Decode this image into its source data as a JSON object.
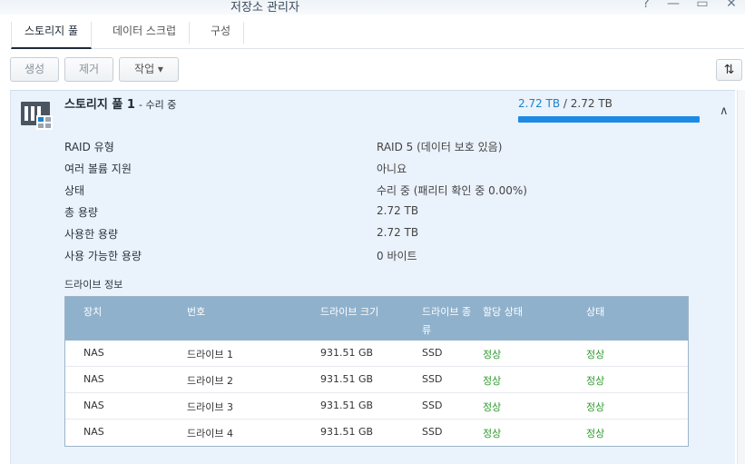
{
  "window": {
    "title": "저장소 관리자",
    "help": "?",
    "minimize": "—",
    "maximize": "▭",
    "close": "✕"
  },
  "tabs": [
    {
      "label": "스토리지 풀",
      "active": true
    },
    {
      "label": "데이터 스크럽",
      "active": false
    },
    {
      "label": "구성",
      "active": false
    }
  ],
  "toolbar": {
    "create": "생성",
    "remove": "제거",
    "action": "작업 ▾",
    "sort_icon": "⇅"
  },
  "pool": {
    "name": "스토리지 풀 1",
    "status": "- 수리 중",
    "used": "2.72 TB",
    "separator": " / ",
    "total": "2.72 TB",
    "usage_fraction": 1.0,
    "collapse": "∧",
    "properties": [
      {
        "label": "RAID 유형",
        "value": "RAID 5 (데이터 보호 있음)"
      },
      {
        "label": "여러 볼륨 지원",
        "value": "아니요"
      },
      {
        "label": "상태",
        "value": "수리 중 (패리티 확인 중 0.00%)"
      },
      {
        "label": "총 용량",
        "value": "2.72 TB"
      },
      {
        "label": "사용한 용량",
        "value": "2.72 TB"
      },
      {
        "label": "사용 가능한 용량",
        "value": "0 바이트"
      }
    ]
  },
  "drives": {
    "section_label": "드라이브 정보",
    "columns": [
      "장치",
      "번호",
      "드라이브 크기",
      "드라이브 종류",
      "할당 상태",
      "상태"
    ],
    "rows": [
      [
        "NAS",
        "드라이브 1",
        "931.51 GB",
        "SSD",
        "정상",
        "정상"
      ],
      [
        "NAS",
        "드라이브 2",
        "931.51 GB",
        "SSD",
        "정상",
        "정상"
      ],
      [
        "NAS",
        "드라이브 3",
        "931.51 GB",
        "SSD",
        "정상",
        "정상"
      ],
      [
        "NAS",
        "드라이브 4",
        "931.51 GB",
        "SSD",
        "정상",
        "정상"
      ]
    ]
  },
  "colors": {
    "accent": "#1e8ae6",
    "ok": "#2e9a2e",
    "table_header": "#8fb1cc",
    "panel_bg": "#eaf2fb"
  }
}
